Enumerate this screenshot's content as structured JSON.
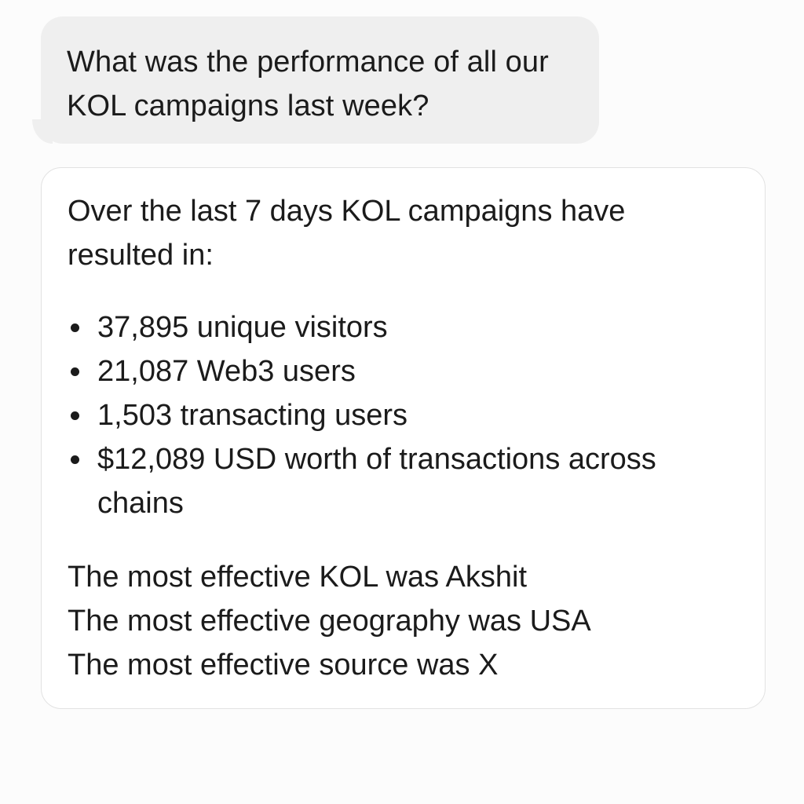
{
  "conversation": {
    "user_message": "What was the performance of all our KOL campaigns last week?",
    "assistant_reply": {
      "intro": "Over the last 7 days KOL campaigns have resulted in:",
      "stats": [
        "37,895 unique visitors",
        "21,087 Web3 users",
        "1,503 transacting users",
        "$12,089 USD worth of transactions across chains"
      ],
      "summary": [
        "The most effective KOL was Akshit",
        "The most effective geography was USA",
        "The most effective source was X"
      ]
    }
  },
  "colors": {
    "background": "#fcfcfc",
    "user_bubble": "#efefef",
    "reply_card": "#ffffff",
    "reply_border": "#e2e2e2",
    "text": "#1b1b1b"
  }
}
